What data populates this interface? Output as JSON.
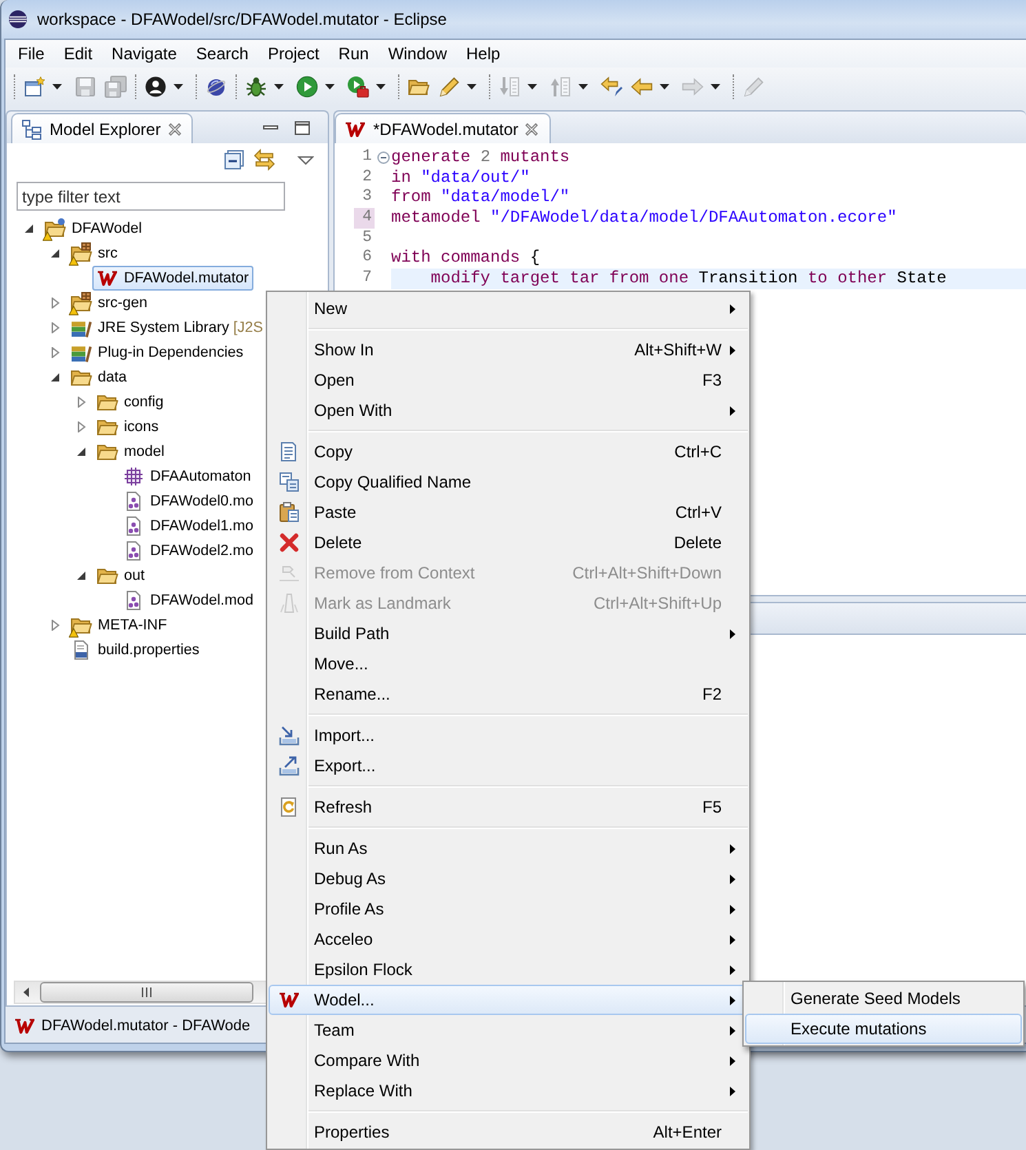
{
  "window": {
    "title": "workspace - DFAWodel/src/DFAWodel.mutator - Eclipse"
  },
  "menu_bar": [
    "File",
    "Edit",
    "Navigate",
    "Search",
    "Project",
    "Run",
    "Window",
    "Help"
  ],
  "toolbar": [
    [
      {
        "dropdown": true,
        "disabled": false
      },
      {
        "dropdown": false,
        "disabled": true
      },
      {
        "dropdown": false,
        "disabled": true
      }
    ],
    [
      {
        "dropdown": true,
        "disabled": false
      }
    ],
    [
      {
        "dropdown": false,
        "disabled": false
      }
    ],
    [
      {
        "dropdown": true,
        "disabled": false
      },
      {
        "dropdown": true,
        "disabled": false
      },
      {
        "dropdown": true,
        "disabled": false
      }
    ],
    [
      {
        "dropdown": false,
        "disabled": false
      },
      {
        "dropdown": true,
        "disabled": false
      }
    ],
    [
      {
        "dropdown": true,
        "disabled": true
      },
      {
        "dropdown": true,
        "disabled": true
      },
      {
        "dropdown": false,
        "disabled": false
      },
      {
        "dropdown": true,
        "disabled": false
      },
      {
        "dropdown": true,
        "disabled": true
      }
    ],
    [
      {
        "dropdown": false,
        "disabled": true
      }
    ]
  ],
  "model_explorer": {
    "tab": {
      "label": "Model Explorer",
      "selected": true
    },
    "filter": {
      "placeholder": "type filter text"
    },
    "tree": [
      {
        "label": "DFAWodel",
        "kind": "project",
        "warning": true,
        "expanded": true,
        "selected": false,
        "children": [
          {
            "label": "src",
            "kind": "source",
            "warning": true,
            "expanded": true,
            "selected": false,
            "children": [
              {
                "label": "DFAWodel.mutator",
                "kind": "wodel",
                "warning": false,
                "selected": true
              }
            ]
          },
          {
            "label": "src-gen",
            "kind": "source",
            "warning": true,
            "expanded": false,
            "selected": false
          },
          {
            "label": "JRE System Library",
            "decoration": "[J2S",
            "kind": "library",
            "warning": false,
            "expanded": false,
            "selected": false
          },
          {
            "label": "Plug-in Dependencies",
            "kind": "library",
            "warning": false,
            "expanded": false,
            "selected": false
          },
          {
            "label": "data",
            "kind": "folder",
            "warning": false,
            "expanded": true,
            "selected": false,
            "children": [
              {
                "label": "config",
                "kind": "folder",
                "warning": false,
                "expanded": false,
                "selected": false
              },
              {
                "label": "icons",
                "kind": "folder",
                "warning": false,
                "expanded": false,
                "selected": false
              },
              {
                "label": "model",
                "kind": "folder",
                "warning": false,
                "expanded": true,
                "selected": false,
                "children": [
                  {
                    "label": "DFAAutomaton",
                    "kind": "ecore",
                    "warning": false,
                    "selected": false
                  },
                  {
                    "label": "DFAWodel0.mo",
                    "kind": "model",
                    "warning": false,
                    "selected": false
                  },
                  {
                    "label": "DFAWodel1.mo",
                    "kind": "model",
                    "warning": false,
                    "selected": false
                  },
                  {
                    "label": "DFAWodel2.mo",
                    "kind": "model",
                    "warning": false,
                    "selected": false
                  }
                ]
              },
              {
                "label": "out",
                "kind": "folder",
                "warning": false,
                "expanded": true,
                "selected": false,
                "children": [
                  {
                    "label": "DFAWodel.mod",
                    "kind": "model",
                    "warning": false,
                    "selected": false
                  }
                ]
              }
            ]
          },
          {
            "label": "META-INF",
            "kind": "folder",
            "warning": true,
            "expanded": false,
            "selected": false
          },
          {
            "label": "build.properties",
            "kind": "properties",
            "warning": false,
            "selected": false
          }
        ]
      }
    ]
  },
  "editor": {
    "tab": {
      "label": "*DFAWodel.mutator",
      "selected": true
    },
    "lines": [
      {
        "number": "1",
        "fold": true,
        "highlighted": false,
        "current": false,
        "tokens": [
          {
            "kind": "keyword",
            "text": "generate "
          },
          {
            "kind": "number",
            "text": "2 "
          },
          {
            "kind": "keyword",
            "text": "mutants"
          }
        ]
      },
      {
        "number": "2",
        "fold": false,
        "highlighted": false,
        "current": false,
        "tokens": [
          {
            "kind": "keyword",
            "text": "in "
          },
          {
            "kind": "string",
            "text": "\"data/out/\""
          }
        ]
      },
      {
        "number": "3",
        "fold": false,
        "highlighted": false,
        "current": false,
        "tokens": [
          {
            "kind": "keyword",
            "text": "from "
          },
          {
            "kind": "string",
            "text": "\"data/model/\""
          }
        ]
      },
      {
        "number": "4",
        "fold": false,
        "highlighted": true,
        "current": false,
        "tokens": [
          {
            "kind": "keyword",
            "text": "metamodel "
          },
          {
            "kind": "string",
            "text": "\"/DFAWodel/data/model/DFAAutomaton.ecore\""
          }
        ]
      },
      {
        "number": "5",
        "fold": false,
        "highlighted": false,
        "current": false
      },
      {
        "number": "6",
        "fold": false,
        "highlighted": false,
        "current": false,
        "tokens": [
          {
            "kind": "keyword",
            "text": "with commands "
          },
          {
            "kind": "plain",
            "text": "{"
          }
        ]
      },
      {
        "number": "7",
        "fold": false,
        "highlighted": false,
        "current": true,
        "tokens": [
          {
            "kind": "keyword",
            "text": "    modify target tar from one "
          },
          {
            "kind": "plain",
            "text": "Transition "
          },
          {
            "kind": "keyword",
            "text": "to other "
          },
          {
            "kind": "plain",
            "text": "State"
          }
        ]
      }
    ]
  },
  "status_bar": {
    "text": "DFAWodel.mutator - DFAWode"
  },
  "context_menu": {
    "groups": [
      [
        {
          "label": "New",
          "submenu": true,
          "disabled": false,
          "selected": false
        }
      ],
      [
        {
          "label": "Show In",
          "shortcut": "Alt+Shift+W",
          "submenu": true,
          "disabled": false,
          "selected": false
        },
        {
          "label": "Open",
          "shortcut": "F3",
          "submenu": false,
          "disabled": false,
          "selected": false
        },
        {
          "label": "Open With",
          "submenu": true,
          "disabled": false,
          "selected": false
        }
      ],
      [
        {
          "label": "Copy",
          "shortcut": "Ctrl+C",
          "submenu": false,
          "disabled": false,
          "selected": false
        },
        {
          "label": "Copy Qualified Name",
          "submenu": false,
          "disabled": false,
          "selected": false
        },
        {
          "label": "Paste",
          "shortcut": "Ctrl+V",
          "submenu": false,
          "disabled": false,
          "selected": false
        },
        {
          "label": "Delete",
          "shortcut": "Delete",
          "submenu": false,
          "disabled": false,
          "selected": false
        },
        {
          "label": "Remove from Context",
          "shortcut": "Ctrl+Alt+Shift+Down",
          "submenu": false,
          "disabled": true,
          "selected": false
        },
        {
          "label": "Mark as Landmark",
          "shortcut": "Ctrl+Alt+Shift+Up",
          "submenu": false,
          "disabled": true,
          "selected": false
        },
        {
          "label": "Build Path",
          "submenu": true,
          "disabled": false,
          "selected": false
        },
        {
          "label": "Move...",
          "submenu": false,
          "disabled": false,
          "selected": false
        },
        {
          "label": "Rename...",
          "shortcut": "F2",
          "submenu": false,
          "disabled": false,
          "selected": false
        }
      ],
      [
        {
          "label": "Import...",
          "submenu": false,
          "disabled": false,
          "selected": false
        },
        {
          "label": "Export...",
          "submenu": false,
          "disabled": false,
          "selected": false
        }
      ],
      [
        {
          "label": "Refresh",
          "shortcut": "F5",
          "submenu": false,
          "disabled": false,
          "selected": false
        }
      ],
      [
        {
          "label": "Run As",
          "submenu": true,
          "disabled": false,
          "selected": false
        },
        {
          "label": "Debug As",
          "submenu": true,
          "disabled": false,
          "selected": false
        },
        {
          "label": "Profile As",
          "submenu": true,
          "disabled": false,
          "selected": false
        },
        {
          "label": "Acceleo",
          "submenu": true,
          "disabled": false,
          "selected": false
        },
        {
          "label": "Epsilon Flock",
          "submenu": true,
          "disabled": false,
          "selected": false
        },
        {
          "label": "Wodel...",
          "submenu": true,
          "disabled": false,
          "selected": true
        },
        {
          "label": "Team",
          "submenu": true,
          "disabled": false,
          "selected": false
        },
        {
          "label": "Compare With",
          "submenu": true,
          "disabled": false,
          "selected": false
        },
        {
          "label": "Replace With",
          "submenu": true,
          "disabled": false,
          "selected": false
        }
      ],
      [
        {
          "label": "Properties",
          "shortcut": "Alt+Enter",
          "submenu": false,
          "disabled": false,
          "selected": false
        }
      ]
    ]
  },
  "submenu": {
    "items": [
      {
        "label": "Generate Seed Models",
        "selected": false
      },
      {
        "label": "Execute mutations",
        "selected": true
      }
    ]
  }
}
